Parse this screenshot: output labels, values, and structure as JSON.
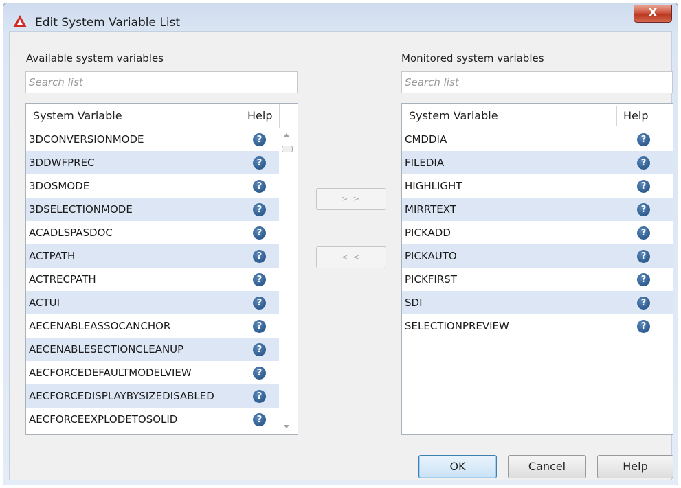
{
  "window": {
    "title": "Edit System Variable List",
    "close_glyph": "X"
  },
  "left": {
    "label": "Available system variables",
    "search_placeholder": "Search list",
    "columns": {
      "name": "System Variable",
      "help": "Help"
    },
    "rows": [
      "3DCONVERSIONMODE",
      "3DDWFPREC",
      "3DOSMODE",
      "3DSELECTIONMODE",
      "ACADLSPASDOC",
      "ACTPATH",
      "ACTRECPATH",
      "ACTUI",
      "AECENABLEASSOCANCHOR",
      "AECENABLESECTIONCLEANUP",
      "AECFORCEDEFAULTMODELVIEW",
      "AECFORCEDISPLAYBYSIZEDISABLED",
      "AECFORCEEXPLODETOSOLID"
    ]
  },
  "right": {
    "label": "Monitored system variables",
    "search_placeholder": "Search list",
    "columns": {
      "name": "System Variable",
      "help": "Help"
    },
    "rows": [
      "CMDDIA",
      "FILEDIA",
      "HIGHLIGHT",
      "MIRRTEXT",
      "PICKADD",
      "PICKAUTO",
      "PICKFIRST",
      "SDI",
      "SELECTIONPREVIEW"
    ]
  },
  "transfer": {
    "add_label": "> >",
    "remove_label": "< <"
  },
  "buttons": {
    "ok": "OK",
    "cancel": "Cancel",
    "help": "Help"
  },
  "help_icon_glyph": "?",
  "colors": {
    "row_alt": "#dce6f4",
    "help_icon": "#2e5c8f",
    "close_button": "#c94a33",
    "ok_border": "#3c7fb1"
  }
}
